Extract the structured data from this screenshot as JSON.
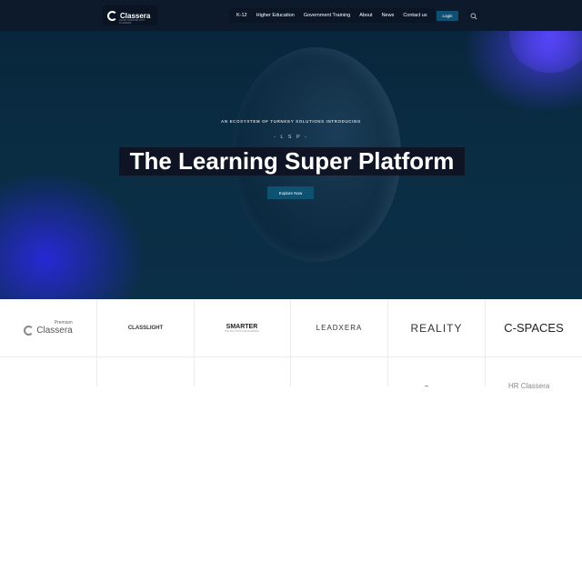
{
  "brand": {
    "name": "Classera",
    "tagline": "LEARN SMARTER WITH CLASSERA"
  },
  "nav": {
    "items": [
      "K-12",
      "Higher Education",
      "Government Training",
      "About",
      "News",
      "Contact us"
    ],
    "login_label": "Login",
    "search_icon": "search-icon"
  },
  "hero": {
    "eyebrow": "AN ECOSYSTEM OF TURNKEY SOLUTIONS INTRODUCING",
    "lsp": "- L S P -",
    "title": "The Learning Super Platform",
    "cta_label": "Explore Now"
  },
  "partners": [
    {
      "small": "Premium",
      "name": "Classera"
    },
    {
      "name": "CLASSLIGHT"
    },
    {
      "name": "SMARTER",
      "sub": "THE SOLUTION FOR LEARNING"
    },
    {
      "name": "LEADXERA"
    },
    {
      "name": "REALITY"
    },
    {
      "name": "C-SPACES"
    }
  ],
  "partners_row2": {
    "partial_text": "HR Classera"
  },
  "colors": {
    "header_bg": "#0d1a2b",
    "hero_bg": "#0a2d44",
    "accent_blue": "#0e5272",
    "glow_purple": "#3c3ce0"
  }
}
